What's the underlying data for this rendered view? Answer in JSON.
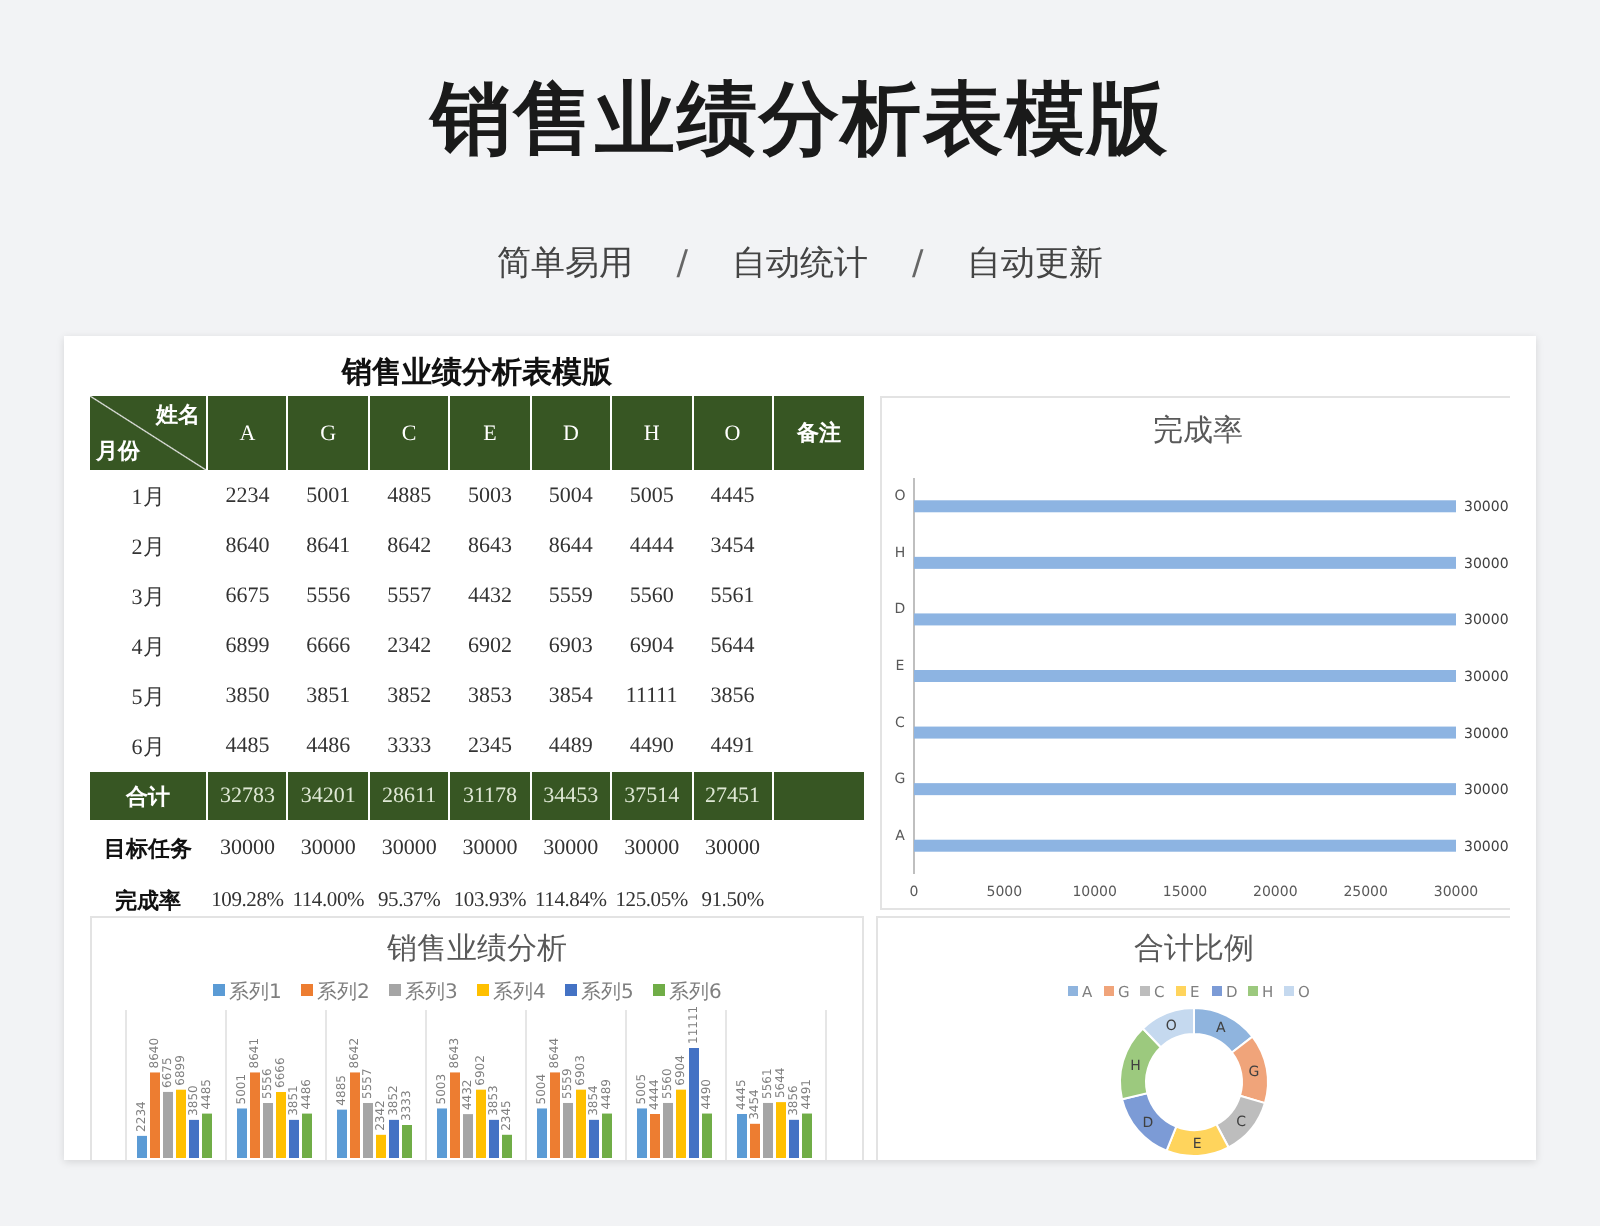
{
  "header": {
    "title": "销售业绩分析表模版",
    "tagline": [
      {
        "kind": "label",
        "text": "简单易用"
      },
      {
        "kind": "separator",
        "text": "/"
      },
      {
        "kind": "label",
        "text": "自动统计"
      },
      {
        "kind": "separator",
        "text": "/"
      },
      {
        "kind": "label",
        "text": "自动更新"
      }
    ]
  },
  "table": {
    "title": "销售业绩分析表模版",
    "corner": {
      "top": "姓名",
      "bottom": "月份"
    },
    "columns": [
      "A",
      "G",
      "C",
      "E",
      "D",
      "H",
      "O",
      "备注"
    ],
    "rows": [
      {
        "kind": "month",
        "label": "1月",
        "cells": [
          "2234",
          "5001",
          "4885",
          "5003",
          "5004",
          "5005",
          "4445"
        ]
      },
      {
        "kind": "month",
        "label": "2月",
        "cells": [
          "8640",
          "8641",
          "8642",
          "8643",
          "8644",
          "4444",
          "3454"
        ]
      },
      {
        "kind": "month",
        "label": "3月",
        "cells": [
          "6675",
          "5556",
          "5557",
          "4432",
          "5559",
          "5560",
          "5561"
        ]
      },
      {
        "kind": "month",
        "label": "4月",
        "cells": [
          "6899",
          "6666",
          "2342",
          "6902",
          "6903",
          "6904",
          "5644"
        ]
      },
      {
        "kind": "month",
        "label": "5月",
        "cells": [
          "3850",
          "3851",
          "3852",
          "3853",
          "3854",
          "11111",
          "3856"
        ]
      },
      {
        "kind": "month",
        "label": "6月",
        "cells": [
          "4485",
          "4486",
          "3333",
          "2345",
          "4489",
          "4490",
          "4491"
        ]
      },
      {
        "kind": "total",
        "label": "合计",
        "cells": [
          "32783",
          "34201",
          "28611",
          "31178",
          "34453",
          "37514",
          "27451"
        ]
      },
      {
        "kind": "target",
        "label": "目标任务",
        "cells": [
          "30000",
          "30000",
          "30000",
          "30000",
          "30000",
          "30000",
          "30000"
        ]
      },
      {
        "kind": "rate",
        "label": "完成率",
        "cells": [
          "109.28%",
          "114.00%",
          "95.37%",
          "103.93%",
          "114.84%",
          "125.05%",
          "91.50%"
        ]
      }
    ]
  },
  "completion_chart": {
    "chart_data": {
      "type": "bar",
      "orientation": "horizontal",
      "title": "完成率",
      "categories": [
        "O",
        "H",
        "D",
        "E",
        "C",
        "G",
        "A"
      ],
      "series": [
        {
          "color": "#8db4e2",
          "values": [
            30000,
            30000,
            30000,
            30000,
            30000,
            30000,
            30000
          ],
          "value_labels": [
            "30000",
            "30000",
            "30000",
            "30000",
            "30000",
            "30000",
            "30000"
          ]
        }
      ],
      "xlim": [
        0,
        30000
      ],
      "xticks": [
        {
          "value": 0,
          "label": "0"
        },
        {
          "value": 5000,
          "label": "5000"
        },
        {
          "value": 10000,
          "label": "10000"
        },
        {
          "value": 15000,
          "label": "15000"
        },
        {
          "value": 20000,
          "label": "20000"
        },
        {
          "value": 25000,
          "label": "25000"
        },
        {
          "value": 30000,
          "label": "30000"
        }
      ],
      "data_labels": true
    }
  },
  "sales_chart": {
    "chart_data": {
      "type": "bar",
      "title": "销售业绩分析",
      "series": [
        {
          "name": "系列1",
          "color": "#5b9bd5",
          "values": [
            2234,
            5001,
            4885,
            5003,
            5004,
            5005,
            4445
          ],
          "value_labels": [
            "2234",
            "5001",
            "4885",
            "5003",
            "5004",
            "5005",
            "4445"
          ]
        },
        {
          "name": "系列2",
          "color": "#ed7d31",
          "values": [
            8640,
            8641,
            8642,
            8643,
            8644,
            4444,
            3454
          ],
          "value_labels": [
            "8640",
            "8641",
            "8642",
            "8643",
            "8644",
            "4444",
            "3454"
          ]
        },
        {
          "name": "系列3",
          "color": "#a5a5a5",
          "values": [
            6675,
            5556,
            5557,
            4432,
            5559,
            5560,
            5561
          ],
          "value_labels": [
            "6675",
            "5556",
            "5557",
            "4432",
            "5559",
            "5560",
            "5561"
          ]
        },
        {
          "name": "系列4",
          "color": "#ffc000",
          "values": [
            6899,
            6666,
            2342,
            6902,
            6903,
            6904,
            5644
          ],
          "value_labels": [
            "6899",
            "6666",
            "2342",
            "6902",
            "6903",
            "6904",
            "5644"
          ]
        },
        {
          "name": "系列5",
          "color": "#4472c4",
          "values": [
            3850,
            3851,
            3852,
            3853,
            3854,
            11111,
            3856
          ],
          "value_labels": [
            "3850",
            "3851",
            "3852",
            "3853",
            "3854",
            "11111",
            "3856"
          ]
        },
        {
          "name": "系列6",
          "color": "#70ad47",
          "values": [
            4485,
            4486,
            3333,
            2345,
            4489,
            4490,
            4491
          ],
          "value_labels": [
            "4485",
            "4486",
            "3333",
            "2345",
            "4489",
            "4490",
            "4491"
          ]
        }
      ],
      "legend": "top",
      "data_labels": true
    }
  },
  "share_chart": {
    "chart_data": {
      "type": "donut",
      "title": "合计比例",
      "categories": [
        "A",
        "G",
        "C",
        "E",
        "D",
        "H",
        "O"
      ],
      "values": [
        14.49,
        15.12,
        12.65,
        13.78,
        15.23,
        16.59,
        12.14
      ],
      "colors": [
        "#8fb4de",
        "#f0a47a",
        "#bdbdbd",
        "#ffd45c",
        "#7c9bd6",
        "#9cc97e",
        "#c5d9ef"
      ],
      "legend": "top",
      "data_labels": true,
      "value_labels": [
        "A",
        "G",
        "C",
        "E",
        "D",
        "H",
        "O"
      ]
    }
  }
}
